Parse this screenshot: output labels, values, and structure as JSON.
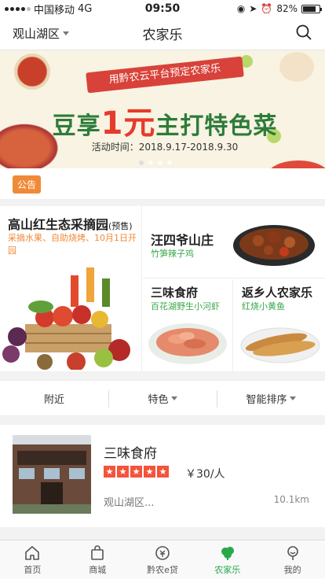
{
  "status_bar": {
    "carrier": "中国移动",
    "network": "4G",
    "time": "09:50",
    "battery": "82%",
    "battery_level": 0.82
  },
  "nav": {
    "location": "观山湖区",
    "title": "农家乐"
  },
  "banner": {
    "ribbon": "用黔农云平台预定农家乐",
    "headline_prefix": "豆享",
    "headline_big": "1元",
    "headline_suffix": "主打特色菜",
    "date": "活动时间：2018.9.17-2018.9.30"
  },
  "notice": {
    "badge": "公告"
  },
  "grid": {
    "main": {
      "title": "高山红生态采摘园",
      "tag": "(预售)",
      "subtitle": "采摘水果、自助烧烤、10月1日开园"
    },
    "top_right": {
      "title": "汪四爷山庄",
      "subtitle": "竹笋辣子鸡"
    },
    "bottom_left": {
      "title": "三味食府",
      "subtitle": "百花湖野生小河虾"
    },
    "bottom_right": {
      "title": "返乡人农家乐",
      "subtitle": "红烧小黄鱼"
    }
  },
  "filters": {
    "nearby": "附近",
    "featured": "特色",
    "sort": "智能排序"
  },
  "result": {
    "name": "三味食府",
    "rating": 5,
    "price": "￥30/人",
    "address": "观山湖区...",
    "distance": "10.1km"
  },
  "tabs": [
    {
      "label": "首页",
      "icon": "home-icon"
    },
    {
      "label": "商城",
      "icon": "shopping-bag-icon"
    },
    {
      "label": "黔农e贷",
      "icon": "loan-icon"
    },
    {
      "label": "农家乐",
      "icon": "farmhouse-icon",
      "active": true
    },
    {
      "label": "我的",
      "icon": "profile-icon"
    }
  ],
  "colors": {
    "accent_green": "#29a84a",
    "orange": "#f08a38",
    "star_red": "#f4543c",
    "banner_red": "#d8423a"
  }
}
